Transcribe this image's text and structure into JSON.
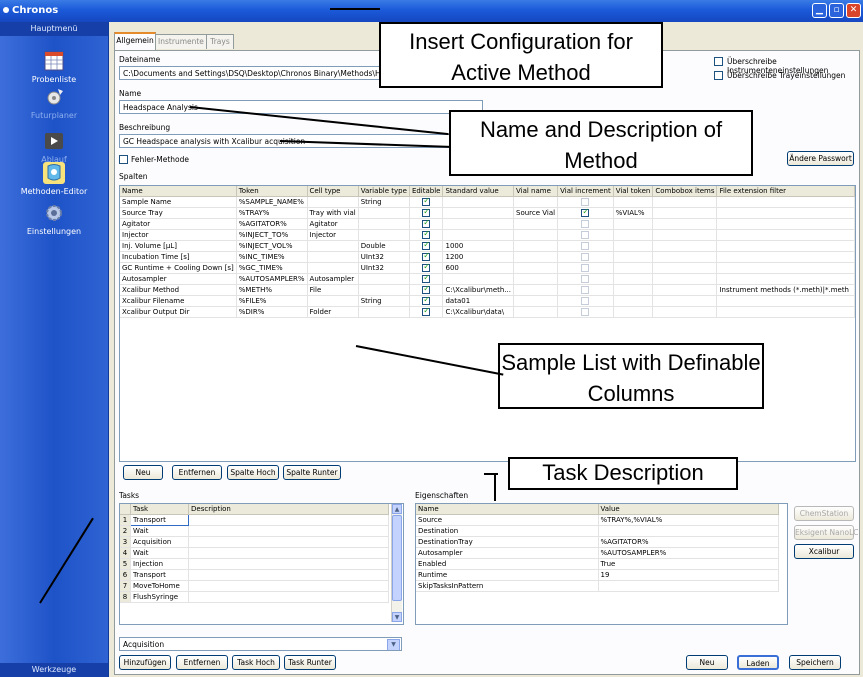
{
  "window": {
    "title": "Chronos"
  },
  "sidebar": {
    "header": "Hauptmenü",
    "footer": "Werkzeuge",
    "items": [
      {
        "label": "Probenliste",
        "icon": "calendar-grid-icon"
      },
      {
        "label": "Futurplaner",
        "icon": "gear-arrow-icon"
      },
      {
        "label": "Ablauf",
        "icon": "play-icon"
      },
      {
        "label": "Methoden-Editor",
        "icon": "method-editor-icon"
      },
      {
        "label": "Einstellungen",
        "icon": "settings-gear-icon"
      }
    ]
  },
  "tabs": [
    {
      "label": "Allgemein"
    },
    {
      "label": "Instrumente"
    },
    {
      "label": "Trays"
    }
  ],
  "form": {
    "dateiname_label": "Dateiname",
    "dateiname_value": "C:\\Documents and Settings\\DSQ\\Desktop\\Chronos Binary\\Methods\\Headspace Xc",
    "overwrite_instruments": "Überschreibe Instrumenteneinstellungen",
    "overwrite_trays": "Überschreibe Trayeinstellungen",
    "name_label": "Name",
    "name_value": "Headspace Analysis",
    "beschreibung_label": "Beschreibung",
    "beschreibung_value": "GC Headspace analysis with Xcalibur acquisition",
    "fehler_methode": "Fehler-Methode",
    "andere_passwort": "Ändere Passwort",
    "spalten_label": "Spalten"
  },
  "columns_grid": {
    "headers": [
      "Name",
      "Token",
      "Cell type",
      "Variable type",
      "Editable",
      "Standard value",
      "Vial name",
      "Vial increment",
      "Vial token",
      "Combobox items",
      "File extension filter"
    ],
    "rows": [
      {
        "name": "Sample Name",
        "token": "%SAMPLE_NAME%",
        "cell_type": "",
        "variable_type": "String",
        "editable": true,
        "standard_value": "",
        "vial_name": "",
        "vial_increment": false,
        "vial_token": "",
        "combobox_items": "",
        "file_filter": ""
      },
      {
        "name": "Source Tray",
        "token": "%TRAY%",
        "cell_type": "Tray with vial",
        "variable_type": "",
        "editable": true,
        "standard_value": "",
        "vial_name": "Source Vial",
        "vial_increment": true,
        "vial_token": "%VIAL%",
        "combobox_items": "",
        "file_filter": ""
      },
      {
        "name": "Agitator",
        "token": "%AGITATOR%",
        "cell_type": "Agitator",
        "variable_type": "",
        "editable": true,
        "standard_value": "",
        "vial_name": "",
        "vial_increment": false,
        "vial_token": "",
        "combobox_items": "",
        "file_filter": ""
      },
      {
        "name": "Injector",
        "token": "%INJECT_TO%",
        "cell_type": "Injector",
        "variable_type": "",
        "editable": true,
        "standard_value": "",
        "vial_name": "",
        "vial_increment": false,
        "vial_token": "",
        "combobox_items": "",
        "file_filter": ""
      },
      {
        "name": "Inj. Volume [µL]",
        "token": "%INJECT_VOL%",
        "cell_type": "",
        "variable_type": "Double",
        "editable": true,
        "standard_value": "1000",
        "vial_name": "",
        "vial_increment": false,
        "vial_token": "",
        "combobox_items": "",
        "file_filter": ""
      },
      {
        "name": "Incubation Time [s]",
        "token": "%INC_TIME%",
        "cell_type": "",
        "variable_type": "UInt32",
        "editable": true,
        "standard_value": "1200",
        "vial_name": "",
        "vial_increment": false,
        "vial_token": "",
        "combobox_items": "",
        "file_filter": ""
      },
      {
        "name": "GC Runtime + Cooling Down [s]",
        "token": "%GC_TIME%",
        "cell_type": "",
        "variable_type": "UInt32",
        "editable": true,
        "standard_value": "600",
        "vial_name": "",
        "vial_increment": false,
        "vial_token": "",
        "combobox_items": "",
        "file_filter": ""
      },
      {
        "name": "Autosampler",
        "token": "%AUTOSAMPLER%",
        "cell_type": "Autosampler",
        "variable_type": "",
        "editable": true,
        "standard_value": "",
        "vial_name": "",
        "vial_increment": false,
        "vial_token": "",
        "combobox_items": "",
        "file_filter": ""
      },
      {
        "name": "Xcalibur Method",
        "token": "%METH%",
        "cell_type": "File",
        "variable_type": "",
        "editable": true,
        "standard_value": "C:\\Xcalibur\\meth...",
        "vial_name": "",
        "vial_increment": false,
        "vial_token": "",
        "combobox_items": "",
        "file_filter": "Instrument methods (*.meth)|*.meth"
      },
      {
        "name": "Xcalibur Filename",
        "token": "%FILE%",
        "cell_type": "",
        "variable_type": "String",
        "editable": true,
        "standard_value": "data01",
        "vial_name": "",
        "vial_increment": false,
        "vial_token": "",
        "combobox_items": "",
        "file_filter": ""
      },
      {
        "name": "Xcalibur Output Dir",
        "token": "%DIR%",
        "cell_type": "Folder",
        "variable_type": "",
        "editable": true,
        "standard_value": "C:\\Xcalibur\\data\\",
        "vial_name": "",
        "vial_increment": false,
        "vial_token": "",
        "combobox_items": "",
        "file_filter": ""
      }
    ],
    "buttons": [
      "Neu",
      "Entfernen",
      "Spalte Hoch",
      "Spalte Runter"
    ]
  },
  "tasks": {
    "label": "Tasks",
    "headers": [
      "Task",
      "Description"
    ],
    "rows": [
      {
        "num": "1",
        "task": "Transport",
        "description": ""
      },
      {
        "num": "2",
        "task": "Wait",
        "description": ""
      },
      {
        "num": "3",
        "task": "Acquisition",
        "description": ""
      },
      {
        "num": "4",
        "task": "Wait",
        "description": ""
      },
      {
        "num": "5",
        "task": "Injection",
        "description": ""
      },
      {
        "num": "6",
        "task": "Transport",
        "description": ""
      },
      {
        "num": "7",
        "task": "MoveToHome",
        "description": ""
      },
      {
        "num": "8",
        "task": "FlushSyringe",
        "description": ""
      }
    ],
    "combo_value": "Acquisition",
    "buttons": [
      "Hinzufügen",
      "Entfernen",
      "Task Hoch",
      "Task Runter"
    ]
  },
  "eigenschaften": {
    "label": "Eigenschaften",
    "headers": [
      "Name",
      "Value"
    ],
    "rows": [
      {
        "name": "Source",
        "value": "%TRAY%,%VIAL%"
      },
      {
        "name": "Destination",
        "value": ""
      },
      {
        "name": "DestinationTray",
        "value": "%AGITATOR%"
      },
      {
        "name": "Autosampler",
        "value": "%AUTOSAMPLER%"
      },
      {
        "name": "Enabled",
        "value": "True"
      },
      {
        "name": "Runtime",
        "value": "19"
      },
      {
        "name": "SkipTasksInPattern",
        "value": ""
      }
    ]
  },
  "side_buttons": [
    "ChemStation",
    "Eksigent NanoLC",
    "Xcalibur"
  ],
  "footer_buttons": [
    "Neu",
    "Laden",
    "Speichern"
  ],
  "callouts": {
    "insert_config": "Insert Configuration for Active Method",
    "name_desc": "Name and Description of Method",
    "sample_list": "Sample List with Definable Columns",
    "task_desc": "Task Description"
  },
  "colors": {
    "sidebar": "#1e53c8",
    "titlebar": "#1b5ad9",
    "background": "#86ccc6",
    "panel": "#ece9d8",
    "accent_tab": "#e68b2c"
  }
}
